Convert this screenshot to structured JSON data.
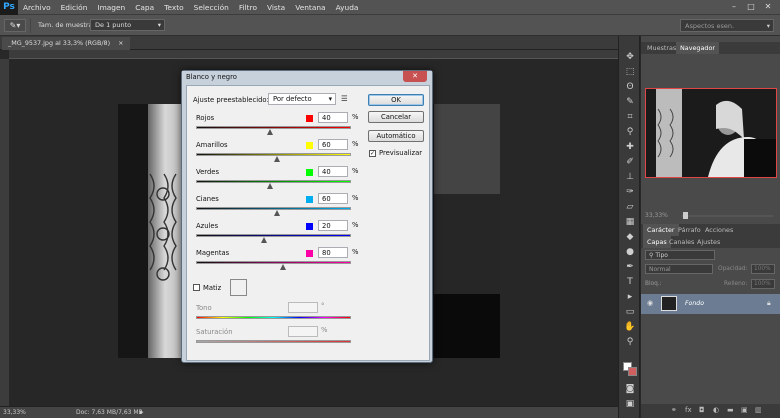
{
  "app": {
    "logo": "Ps",
    "menu": [
      "Archivo",
      "Edición",
      "Imagen",
      "Capa",
      "Texto",
      "Selección",
      "Filtro",
      "Vista",
      "Ventana",
      "Ayuda"
    ],
    "win_min": "–",
    "win_max": "□",
    "win_close": "✕"
  },
  "options": {
    "sample_label": "Tam. de muestra:",
    "sample_value": "De 1 punto",
    "workspace_value": "Aspectos esen."
  },
  "document": {
    "tab_label": "_MG_9537.jpg al 33,3% (RGB/8)",
    "tab_close": "×"
  },
  "status": {
    "zoom": "33,33%",
    "doc_info": "Doc: 7,63 MB/7,63 MB"
  },
  "navigator": {
    "tabs": [
      "Muestras",
      "Navegador"
    ],
    "zoom": "33,33%"
  },
  "char_panel": {
    "tabs": [
      "Carácter",
      "Párrafo",
      "Acciones"
    ]
  },
  "layers": {
    "tabs": [
      "Capas",
      "Canales",
      "Ajustes"
    ],
    "filter_kind": "Tipo",
    "blend_mode": "Normal",
    "opacity_label": "Opacidad:",
    "opacity_value": "100%",
    "lock_label": "Bloq.:",
    "fill_label": "Relleno:",
    "fill_value": "100%",
    "layer_name": "Fondo"
  },
  "dialog": {
    "title": "Blanco y negro",
    "close": "✕",
    "preset_label": "Ajuste preestablecido:",
    "preset_value": "Por defecto",
    "buttons": {
      "ok": "OK",
      "cancel": "Cancelar",
      "auto": "Automático"
    },
    "preview_label": "Previsualizar",
    "preview_checked": true,
    "sliders": [
      {
        "label": "Rojos",
        "value": "40",
        "unit": "%",
        "color": "#ff0000"
      },
      {
        "label": "Amarillos",
        "value": "60",
        "unit": "%",
        "color": "#ffff00"
      },
      {
        "label": "Verdes",
        "value": "40",
        "unit": "%",
        "color": "#00ff00"
      },
      {
        "label": "Cianes",
        "value": "60",
        "unit": "%",
        "color": "#00aeef"
      },
      {
        "label": "Azules",
        "value": "20",
        "unit": "%",
        "color": "#0000ff"
      },
      {
        "label": "Magentas",
        "value": "80",
        "unit": "%",
        "color": "#ff00a8"
      }
    ],
    "tint_label": "Matiz",
    "tint_checked": false,
    "hue_label": "Tono",
    "hue_unit": "°",
    "saturation_label": "Saturación",
    "saturation_unit": "%"
  }
}
